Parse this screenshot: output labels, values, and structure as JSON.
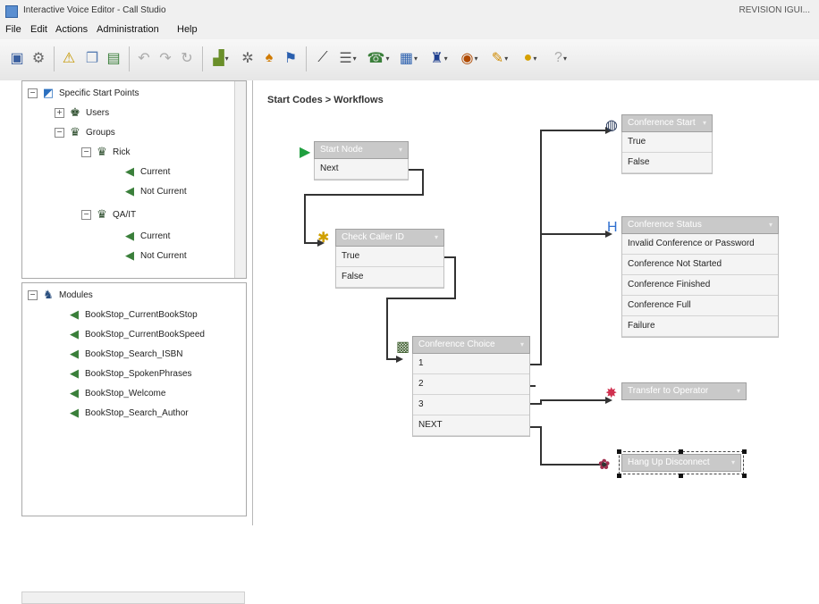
{
  "window": {
    "title": "Interactive Voice Editor - Call Studio",
    "right_label": "REVISION IGUI..."
  },
  "menu": [
    "File",
    "Edit",
    "Actions",
    "Administration",
    "Help"
  ],
  "toolbar_icons": [
    "save-icon",
    "settings-icon",
    "warning-icon",
    "copy-icon",
    "paste-icon",
    "undo-icon",
    "redo-icon",
    "refresh-icon",
    "chart-icon",
    "gear-icon",
    "alert-icon",
    "flag-icon",
    "line-icon",
    "list-icon",
    "phone-icon",
    "card-icon",
    "user-icon",
    "record-icon",
    "edit-icon",
    "stop-icon",
    "help-icon"
  ],
  "tree": {
    "title": "Specific Start Points",
    "users": "Users",
    "groups": "Groups",
    "group1": "Rick",
    "group2": "QA/IT",
    "current": "Current",
    "not_current": "Not Current"
  },
  "modules": {
    "title": "Modules",
    "items": [
      "BookStop_CurrentBookStop",
      "BookStop_CurrentBookSpeed",
      "BookStop_Search_ISBN",
      "BookStop_SpokenPhrases",
      "BookStop_Welcome",
      "BookStop_Search_Author"
    ]
  },
  "canvas": {
    "breadcrumb": "Start Codes > Workflows",
    "nodes": {
      "start": {
        "title": "Start Node",
        "rows": [
          "Next"
        ]
      },
      "check": {
        "title": "Check Caller ID",
        "rows": [
          "True",
          "False"
        ]
      },
      "menu": {
        "title": "Conference Choice",
        "rows": [
          "1",
          "2",
          "3",
          "NEXT"
        ]
      },
      "confstart": {
        "title": "Conference Start",
        "rows": [
          "True",
          "False"
        ]
      },
      "status": {
        "title": "Conference Status",
        "rows": [
          "Invalid Conference or Password",
          "Conference Not Started",
          "Conference Finished",
          "Conference Full",
          "Failure"
        ]
      },
      "transfer": {
        "title": "Transfer to Operator"
      },
      "disconnect": {
        "title": "Hang Up Disconnect"
      }
    }
  }
}
